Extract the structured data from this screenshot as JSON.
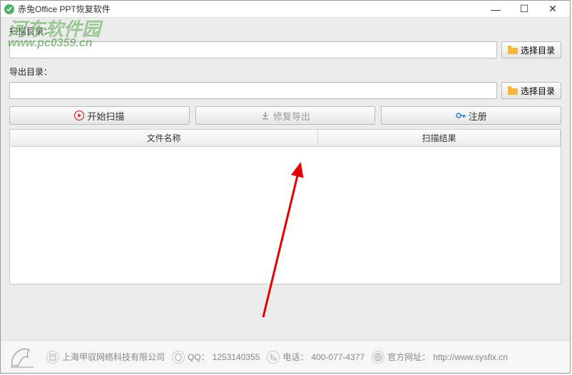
{
  "window": {
    "title": "赤兔Office PPT恢复软件"
  },
  "watermark": {
    "main": "河东软件园",
    "sub": "www.pc0359.cn"
  },
  "labels": {
    "scan_dir": "扫描目录：",
    "export_dir": "导出目录："
  },
  "buttons": {
    "browse": "选择目录",
    "start_scan": "开始扫描",
    "repair_export": "修复导出",
    "register": "注册"
  },
  "table": {
    "col_filename": "文件名称",
    "col_result": "扫描结果"
  },
  "status": {
    "company": "上海甲驭网络科技有限公司",
    "qq_label": "QQ：",
    "qq_value": "1253140355",
    "tel_label": "电话：",
    "tel_value": "400-077-4377",
    "site_label": "官方网址：",
    "site_value": "http://www.sysfix.cn"
  }
}
